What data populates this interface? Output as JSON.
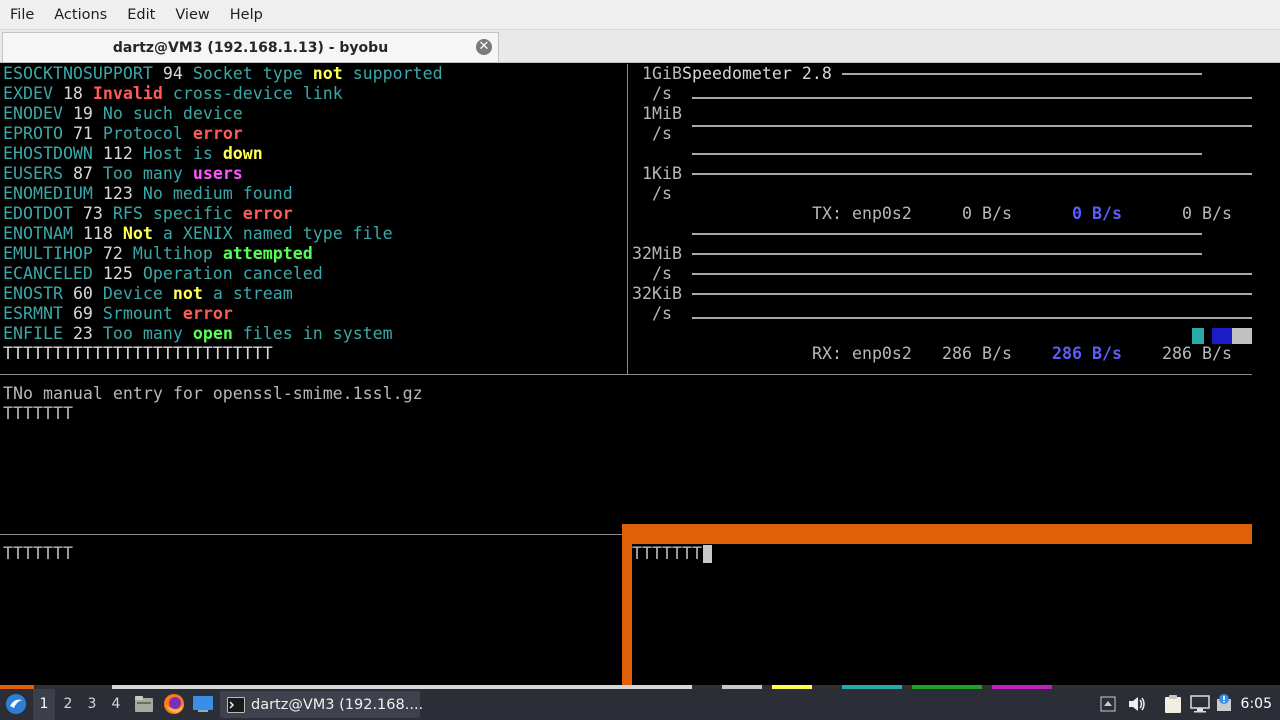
{
  "menubar": {
    "file": "File",
    "actions": "Actions",
    "edit": "Edit",
    "view": "View",
    "help": "Help"
  },
  "tab": {
    "title": "dartz@VM3 (192.168.1.13) - byobu",
    "close_glyph": "✕"
  },
  "errno_pane": {
    "lines": [
      [
        {
          "t": "ESOCKTNOSUPPORT",
          "c": "cyan"
        },
        {
          "t": " 94 ",
          "c": "white"
        },
        {
          "t": "Socket type ",
          "c": "cyan"
        },
        {
          "t": "not",
          "c": "yellow"
        },
        {
          "t": " supported",
          "c": "cyan"
        }
      ],
      [
        {
          "t": "EXDEV",
          "c": "cyan"
        },
        {
          "t": " 18 ",
          "c": "white"
        },
        {
          "t": "Invalid",
          "c": "red"
        },
        {
          "t": " cross-device link",
          "c": "cyan"
        }
      ],
      [
        {
          "t": "ENODEV",
          "c": "cyan"
        },
        {
          "t": " 19 ",
          "c": "white"
        },
        {
          "t": "No such device",
          "c": "cyan"
        }
      ],
      [
        {
          "t": "EPROTO",
          "c": "cyan"
        },
        {
          "t": " 71 ",
          "c": "white"
        },
        {
          "t": "Protocol ",
          "c": "cyan"
        },
        {
          "t": "error",
          "c": "red"
        }
      ],
      [
        {
          "t": "EHOSTDOWN",
          "c": "cyan"
        },
        {
          "t": " 112 ",
          "c": "white"
        },
        {
          "t": "Host is ",
          "c": "cyan"
        },
        {
          "t": "down",
          "c": "yellow"
        }
      ],
      [
        {
          "t": "EUSERS",
          "c": "cyan"
        },
        {
          "t": " 87 ",
          "c": "white"
        },
        {
          "t": "Too many ",
          "c": "cyan"
        },
        {
          "t": "users",
          "c": "magenta"
        }
      ],
      [
        {
          "t": "ENOMEDIUM",
          "c": "cyan"
        },
        {
          "t": " 123 ",
          "c": "white"
        },
        {
          "t": "No medium found",
          "c": "cyan"
        }
      ],
      [
        {
          "t": "EDOTDOT",
          "c": "cyan"
        },
        {
          "t": " 73 ",
          "c": "white"
        },
        {
          "t": "RFS specific ",
          "c": "cyan"
        },
        {
          "t": "error",
          "c": "red"
        }
      ],
      [
        {
          "t": "ENOTNAM",
          "c": "cyan"
        },
        {
          "t": " 118 ",
          "c": "white"
        },
        {
          "t": "Not",
          "c": "yellow"
        },
        {
          "t": " a XENIX named type file",
          "c": "cyan"
        }
      ],
      [
        {
          "t": "EMULTIHOP",
          "c": "cyan"
        },
        {
          "t": " 72 ",
          "c": "white"
        },
        {
          "t": "Multihop ",
          "c": "cyan"
        },
        {
          "t": "attempted",
          "c": "green"
        }
      ],
      [
        {
          "t": "ECANCELED",
          "c": "cyan"
        },
        {
          "t": " 125 ",
          "c": "white"
        },
        {
          "t": "Operation canceled",
          "c": "cyan"
        }
      ],
      [
        {
          "t": "ENOSTR",
          "c": "cyan"
        },
        {
          "t": " 60 ",
          "c": "white"
        },
        {
          "t": "Device ",
          "c": "cyan"
        },
        {
          "t": "not",
          "c": "yellow"
        },
        {
          "t": " a stream",
          "c": "cyan"
        }
      ],
      [
        {
          "t": "ESRMNT",
          "c": "cyan"
        },
        {
          "t": " 69 ",
          "c": "white"
        },
        {
          "t": "Srmount ",
          "c": "cyan"
        },
        {
          "t": "error",
          "c": "red"
        }
      ],
      [
        {
          "t": "ENFILE",
          "c": "cyan"
        },
        {
          "t": " 23 ",
          "c": "white"
        },
        {
          "t": "Too many ",
          "c": "cyan"
        },
        {
          "t": "open",
          "c": "green"
        },
        {
          "t": " files in system",
          "c": "cyan"
        }
      ]
    ],
    "trailing": "TTTTTTTTTTTTTTTTTTTTTTTTTTT"
  },
  "speedometer": {
    "title": "Speedometer 2.8",
    "tx_scale": {
      "top": "1GiB",
      "unit1": "/s",
      "mid": "1MiB",
      "unit2": "/s",
      "low": "1KiB",
      "unit3": "/s"
    },
    "tx_label": "TX: enp0s2",
    "tx_current": "0 B/s",
    "tx_avg": "0 B/s",
    "tx_max": "0 B/s",
    "rx_scale": {
      "top": "32MiB",
      "unit1": "/s",
      "low": "32KiB",
      "unit2": "/s"
    },
    "rx_label": "RX: enp0s2",
    "rx_current": "286 B/s",
    "rx_avg": "286 B/s",
    "rx_max": "286 B/s",
    "colors": {
      "accent_teal": "#2aa9a9",
      "accent_blue": "#1c1cc8",
      "bar_gray": "#c0c0c0"
    }
  },
  "middle_pane": {
    "line1": "TNo manual entry for openssl-smime.1ssl.gz",
    "line2": "TTTTTTT"
  },
  "bottom_left_pane": {
    "line1": "TTTTTTT"
  },
  "bottom_right_pane": {
    "line1": "TTTTTTT",
    "active_border_color": "#e0600a"
  },
  "taskbar": {
    "workspaces": [
      "1",
      "2",
      "3",
      "4"
    ],
    "task_label": "dartz@VM3 (192.168....",
    "clock": "6:05",
    "icons": [
      "lubuntu-start-icon",
      "file-manager-icon",
      "firefox-icon",
      "desktop-icon",
      "terminal-icon",
      "tray-up-arrow-icon",
      "volume-icon",
      "clipboard-icon",
      "network-icon",
      "update-notifier-icon"
    ]
  }
}
